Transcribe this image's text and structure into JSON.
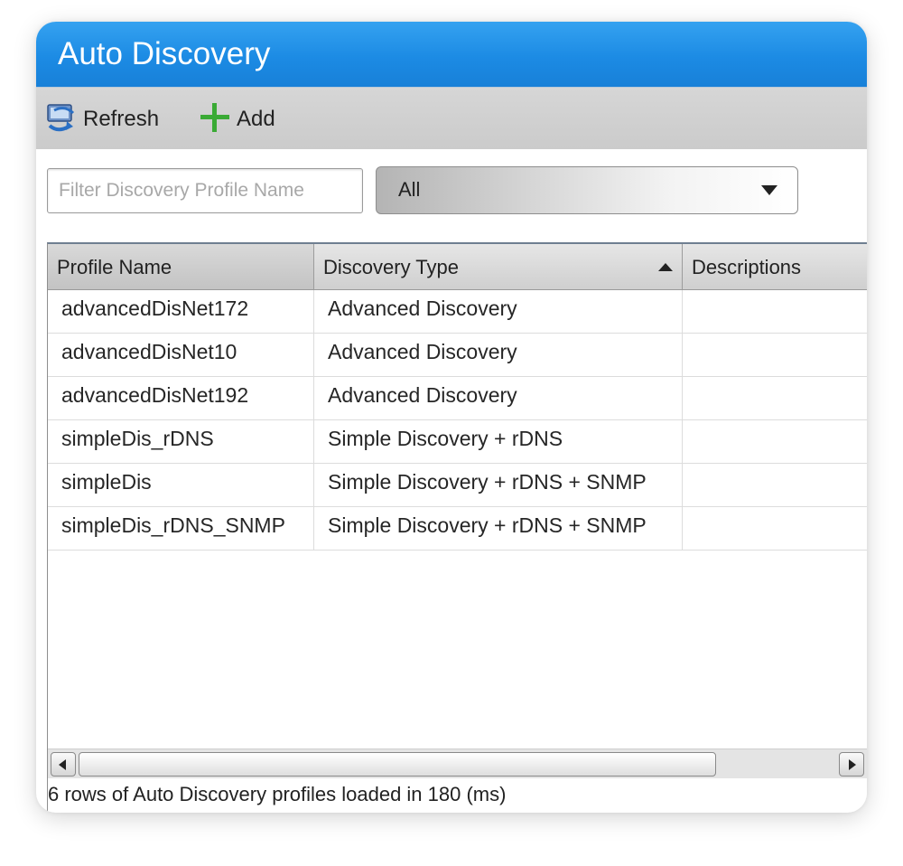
{
  "window": {
    "title": "Auto Discovery"
  },
  "toolbar": {
    "refresh_label": "Refresh",
    "refresh_icon": "refresh-icon",
    "add_label": "Add",
    "add_icon": "plus-icon",
    "add_icon_color": "#3aaa35"
  },
  "filter": {
    "placeholder": "Filter Discovery Profile Name",
    "value": ""
  },
  "type_select": {
    "selected": "All"
  },
  "grid": {
    "columns": [
      "Profile Name",
      "Discovery Type",
      "Descriptions"
    ],
    "sorted_column": "Discovery Type",
    "sort_direction": "ascending",
    "rows": [
      [
        "advancedDisNet172",
        "Advanced Discovery",
        ""
      ],
      [
        "advancedDisNet10",
        "Advanced Discovery",
        ""
      ],
      [
        "advancedDisNet192",
        "Advanced Discovery",
        ""
      ],
      [
        "simpleDis_rDNS",
        "Simple Discovery + rDNS",
        ""
      ],
      [
        "simpleDis",
        "Simple Discovery + rDNS + SNMP",
        ""
      ],
      [
        "simpleDis_rDNS_SNMP",
        "Simple Discovery + rDNS + SNMP",
        ""
      ]
    ]
  },
  "status": {
    "text": "6 rows of Auto Discovery profiles loaded in 180 (ms)"
  },
  "colors": {
    "title_bar": "#1c8be4",
    "toolbar": "#d0d0d0"
  }
}
